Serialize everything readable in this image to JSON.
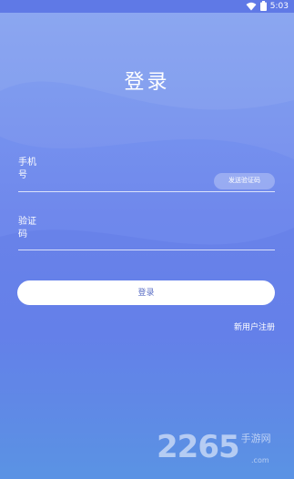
{
  "status_bar": {
    "time": "5:03",
    "icons": [
      "wifi-icon",
      "battery-icon"
    ]
  },
  "page": {
    "title": "登录"
  },
  "form": {
    "phone_label": "手机\n号",
    "code_label": "验证\n码",
    "send_code_label": "发送验证码",
    "login_label": "登录",
    "register_label": "新用户注册"
  },
  "watermark": {
    "number": "2265",
    "suffix": "手游网",
    "url": ".com"
  },
  "colors": {
    "background_top": "#7f9ff1",
    "background_bottom": "#5f9ae6",
    "button_text": "#5b6fc5"
  }
}
